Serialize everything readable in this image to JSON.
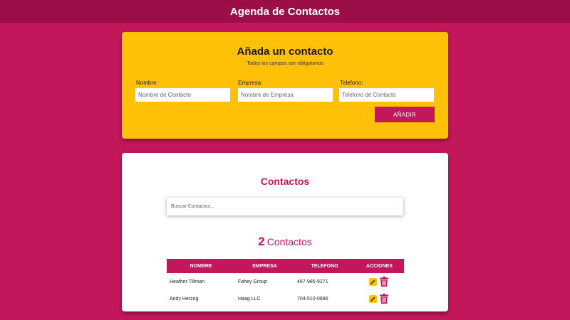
{
  "header": {
    "title": "Agenda de Contactos"
  },
  "add_form": {
    "title": "Añada un contacto",
    "subtitle": "Todos los campos son obligatorios",
    "fields": [
      {
        "label": "Nombre:",
        "placeholder": "Nombre de Contacto",
        "value": ""
      },
      {
        "label": "Empresa:",
        "placeholder": "Nombre de Empresa",
        "value": ""
      },
      {
        "label": "Telefono:",
        "placeholder": "Telefono de Contacto",
        "value": ""
      }
    ],
    "submit_label": "AÑADIR"
  },
  "contacts": {
    "title": "Contactos",
    "search_placeholder": "Buscar Contactos...",
    "count": "2",
    "count_label": "Contactos",
    "columns": [
      "NOMBRE",
      "EMPRESA",
      "TELEFONO",
      "ACCIONES"
    ],
    "rows": [
      {
        "name": "Heather Tillman",
        "company": "Fahey Group",
        "phone": "467-985-9271"
      },
      {
        "name": "Andy Herzog",
        "company": "Haag LLC",
        "phone": "704-510-0886"
      }
    ]
  },
  "colors": {
    "background": "#c2185b",
    "header": "#9c0e47",
    "form_card": "#ffc107",
    "accent": "#c2185b",
    "edit_button": "#ffc107"
  },
  "icons": {
    "edit": "pencil-icon",
    "delete": "trash-icon"
  }
}
